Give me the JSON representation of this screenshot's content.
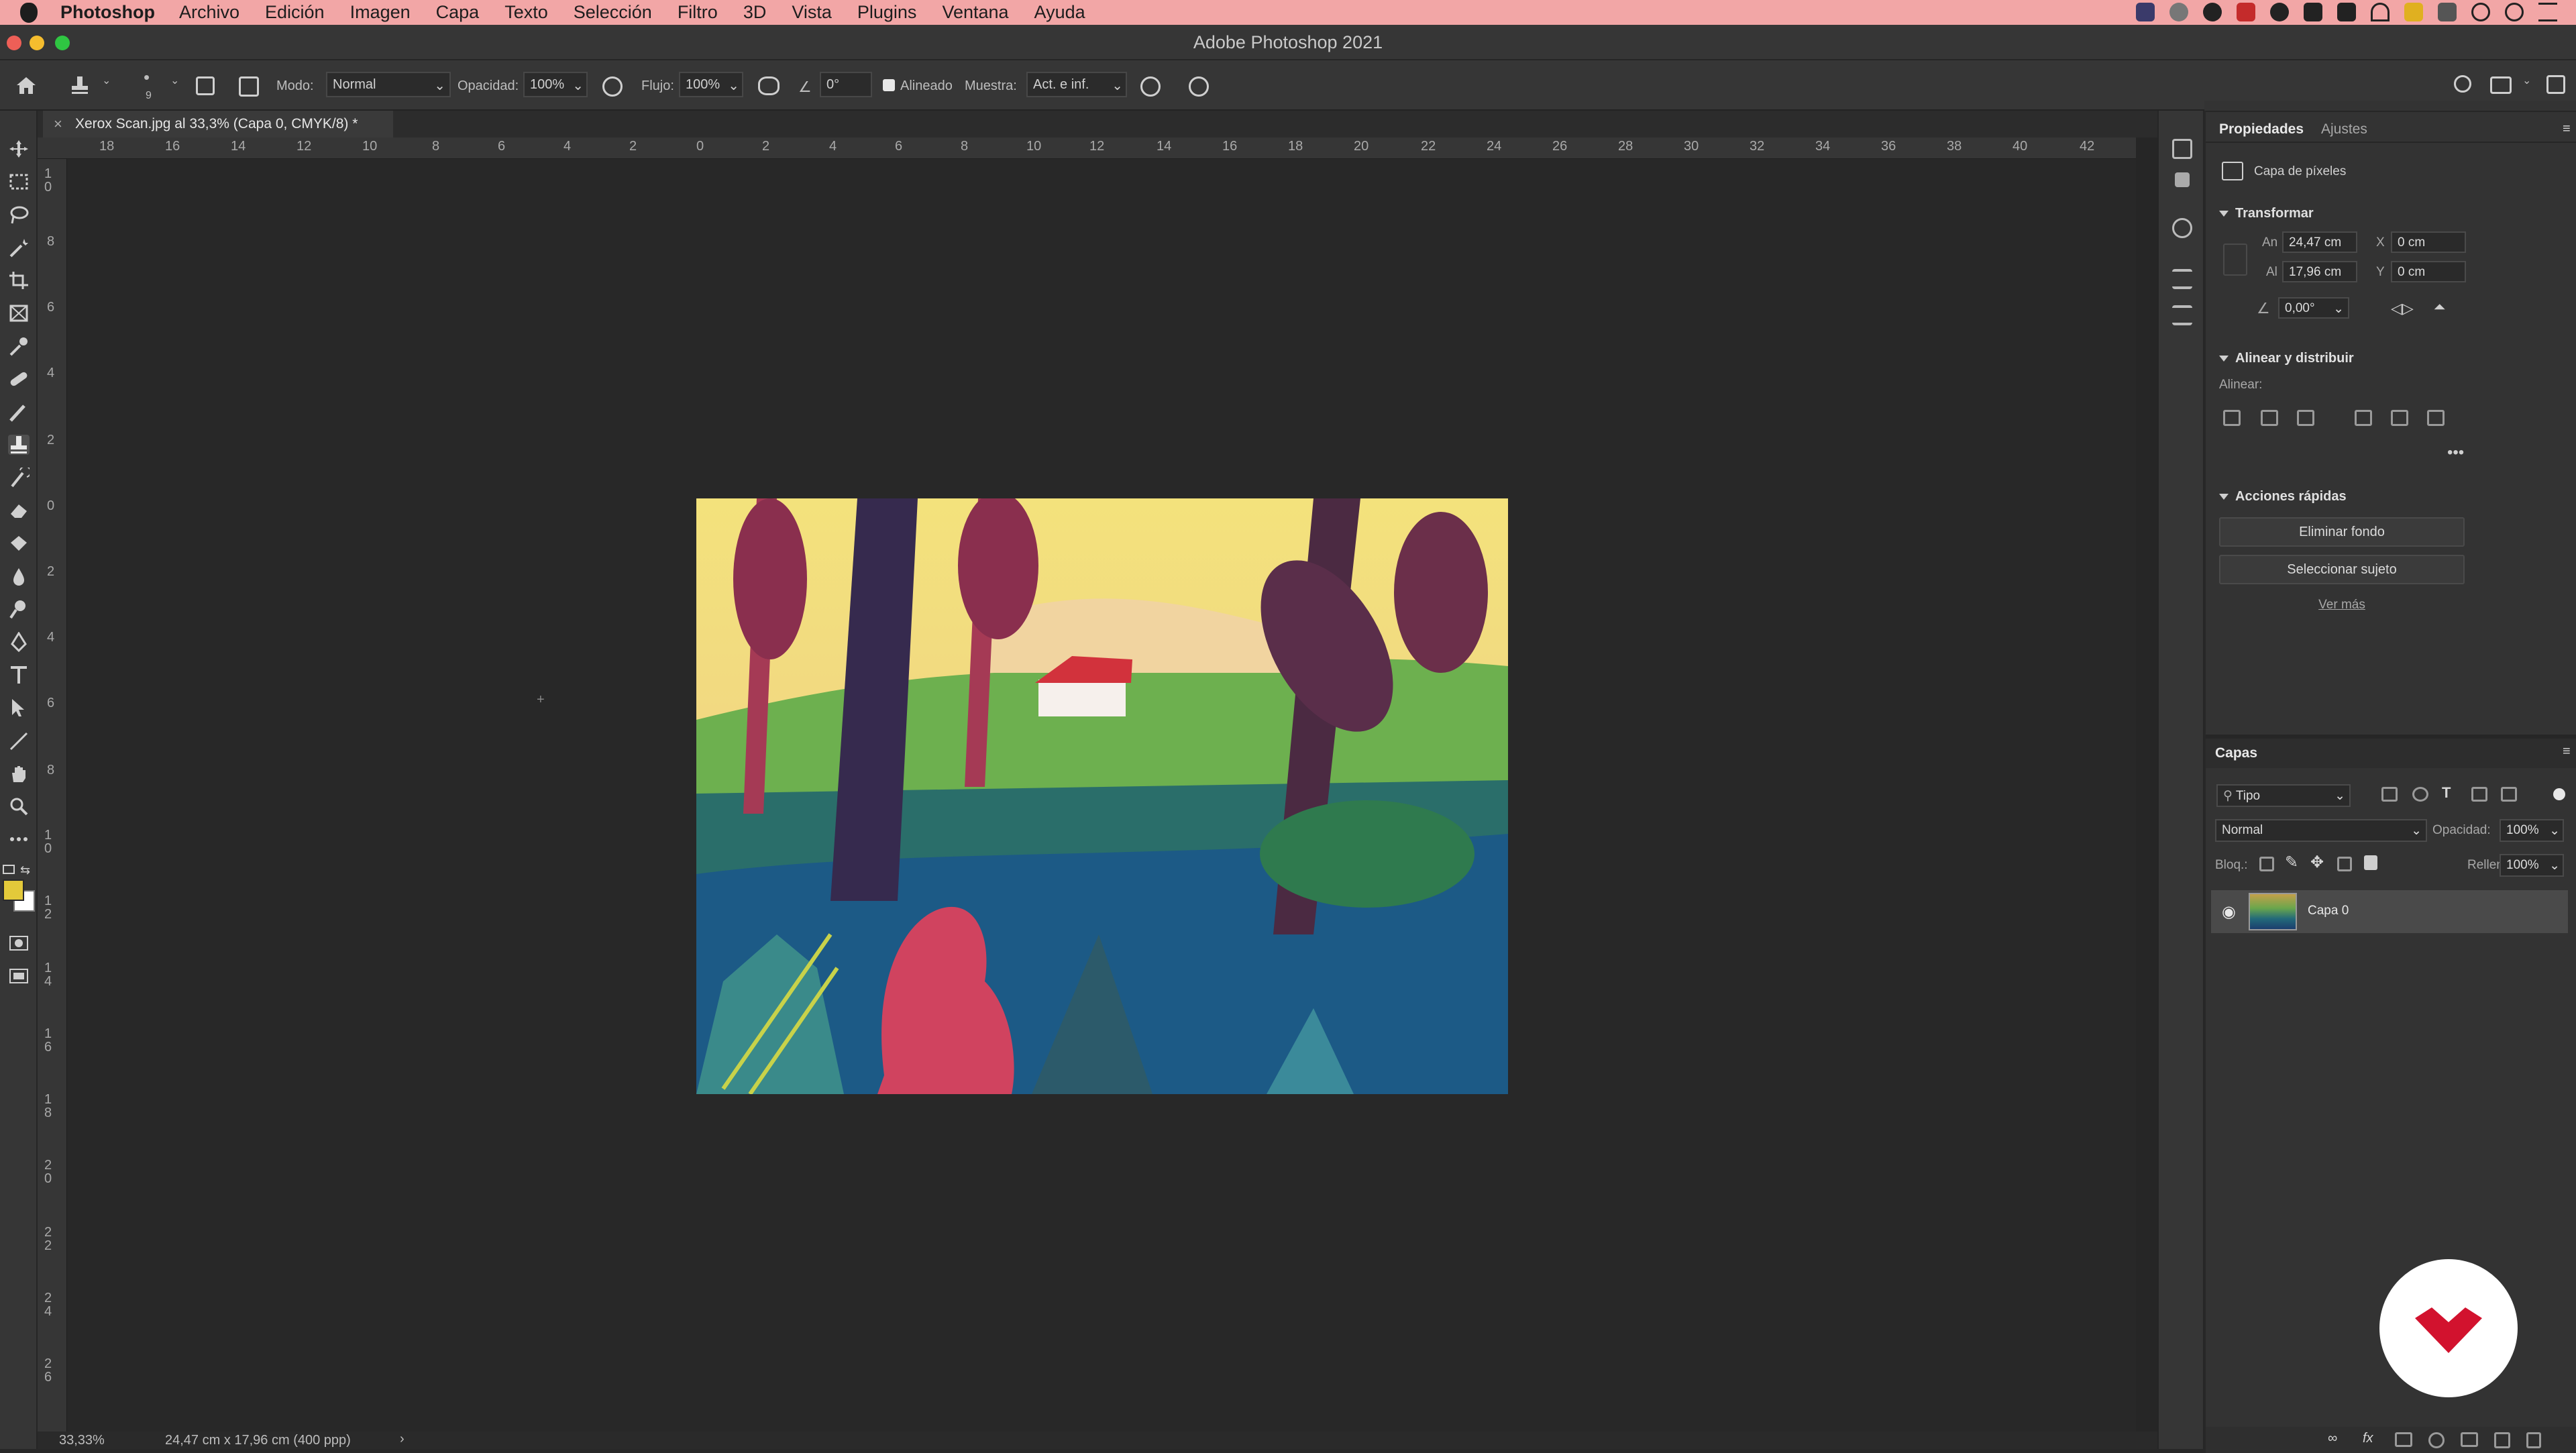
{
  "menubar": {
    "app_name": "Photoshop",
    "items": [
      "Archivo",
      "Edición",
      "Imagen",
      "Capa",
      "Texto",
      "Selección",
      "Filtro",
      "3D",
      "Vista",
      "Plugins",
      "Ventana",
      "Ayuda"
    ]
  },
  "window": {
    "title": "Adobe Photoshop 2021"
  },
  "options": {
    "brush_size": "9",
    "mode_label": "Modo:",
    "mode_value": "Normal",
    "opacity_label": "Opacidad:",
    "opacity_value": "100%",
    "flow_label": "Flujo:",
    "flow_value": "100%",
    "angle_value": "0°",
    "aligned_label": "Alineado",
    "sample_label": "Muestra:",
    "sample_value": "Act. e inf."
  },
  "document": {
    "tab_title": "Xerox Scan.jpg al 33,3% (Capa 0, CMYK/8) *",
    "zoom": "33,33%",
    "size_info": "24,47 cm x 17,96 cm (400 ppp)"
  },
  "rulers": {
    "horizontal": [
      "18",
      "16",
      "14",
      "12",
      "10",
      "8",
      "6",
      "4",
      "2",
      "0",
      "2",
      "4",
      "6",
      "8",
      "10",
      "12",
      "14",
      "16",
      "18",
      "20",
      "22",
      "24",
      "26",
      "28",
      "30",
      "32",
      "34",
      "36",
      "38",
      "40",
      "42"
    ],
    "vertical": [
      "10",
      "8",
      "6",
      "4",
      "2",
      "0",
      "2",
      "4",
      "6",
      "8",
      "10",
      "12",
      "14",
      "16",
      "18",
      "20",
      "22",
      "24",
      "26"
    ]
  },
  "properties": {
    "tab_active": "Propiedades",
    "tab_other": "Ajustes",
    "layer_type": "Capa de píxeles",
    "transform": {
      "title": "Transformar",
      "w_label": "An",
      "w_value": "24,47 cm",
      "h_label": "Al",
      "h_value": "17,96 cm",
      "x_label": "X",
      "x_value": "0 cm",
      "y_label": "Y",
      "y_value": "0 cm",
      "angle_value": "0,00°"
    },
    "align": {
      "title": "Alinear y distribuir",
      "label": "Alinear:"
    },
    "quick_actions": {
      "title": "Acciones rápidas",
      "remove_bg": "Eliminar fondo",
      "select_subject": "Seleccionar sujeto",
      "see_more": "Ver más"
    }
  },
  "layers": {
    "tab": "Capas",
    "filter": "Tipo",
    "blend_mode": "Normal",
    "opacity_label": "Opacidad:",
    "opacity_value": "100%",
    "lock_label": "Bloq.:",
    "fill_label": "Relleno:",
    "fill_value": "100%",
    "items": [
      {
        "name": "Capa 0"
      }
    ]
  },
  "colors": {
    "foreground": "#e3c93a",
    "background": "#ffffff",
    "accent_red": "#d2122e"
  }
}
